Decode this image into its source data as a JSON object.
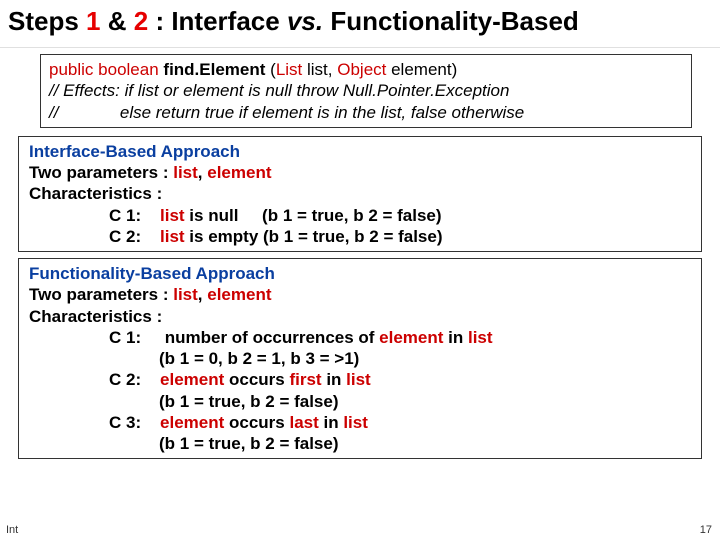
{
  "title": {
    "steps_label": "Steps",
    "step1": "1",
    "amp": " & ",
    "step2": "2",
    "colon": " : ",
    "lhs": "Interface",
    "vs": "vs.",
    "rhs": "Functionality-Based"
  },
  "signature": {
    "public": "public",
    "boolean": "boolean",
    "method": "find.Element",
    "open": " (",
    "t1": "List",
    "p1": " list, ",
    "t2": "Object",
    "p2": " element)",
    "effects_label": "// Effects:",
    "eff1": " if list or element is null throw Null.Pointer.Exception",
    "cont": "//             ",
    "eff2": "else return true if element is in the list, false otherwise"
  },
  "interface_approach": {
    "heading": "Interface-Based Approach",
    "line2a": "Two parameters : ",
    "list": "list",
    "comma": ", ",
    "element": "element",
    "chars": "Characteristics :",
    "c1_label": "C 1:    ",
    "c1_text_a": "list",
    "c1_text_b": " is null     ",
    "c1_vals": "(b 1 = true, b 2 = false)",
    "c2_label": "C 2:    ",
    "c2_text_a": "list",
    "c2_text_b": " is empty ",
    "c2_vals": "(b 1 = true, b 2 = false)"
  },
  "func_approach": {
    "heading": "Functionality-Based Approach",
    "line2a": "Two parameters : ",
    "list": "list",
    "comma": ", ",
    "element": "element",
    "chars": "Characteristics :",
    "c1_label": "C 1:     ",
    "c1_text_a": "number of occurrences of ",
    "c1_elem": "element",
    "c1_text_b": " in ",
    "c1_list": "list",
    "c1_vals": "(b 1 =  0, b 2 =  1, b 3 =  >1)",
    "c2_label": "C 2:    ",
    "c2_elem": "element",
    "c2_text": " occurs ",
    "c2_first": "first",
    "c2_text2": " in ",
    "c2_list": "list",
    "c2_vals": "(b 1 = true, b 2 = false)",
    "c3_label": "C 3:    ",
    "c3_elem": "element",
    "c3_text": " occurs ",
    "c3_last": "last",
    "c3_text2": " in ",
    "c3_list": "list",
    "c3_vals": "(b 1 = true, b 2 = false)"
  },
  "footnote": "Int",
  "pagenum": "17"
}
